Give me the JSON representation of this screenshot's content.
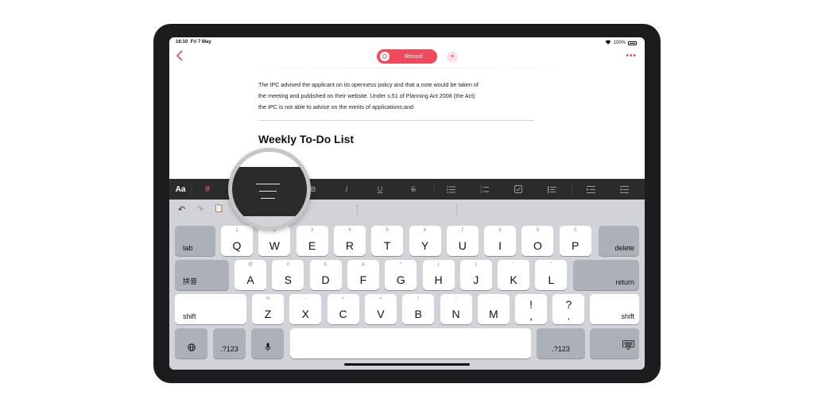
{
  "status": {
    "time": "16:10",
    "date": "Fri 7 May",
    "battery": "100%"
  },
  "nav": {
    "record_label": "Record",
    "more": "•••",
    "back": "‹",
    "sparkle": "✦"
  },
  "doc": {
    "paragraph_lines": [
      "The IPC advised the applicant on its openness policy and that a note would be taken of",
      "the meeting and published on their website. Under s.51 of Planning Act 2008 (the Act)",
      "the IPC is not able to advise on the merits of applications;and"
    ],
    "heading": "Weekly To-Do List"
  },
  "toolbar": {
    "aa": "Aa",
    "hash": "#",
    "bold": "B",
    "italic": "I",
    "underline": "U",
    "strike": "S",
    "bullets": "☰",
    "numbers": "≡",
    "checkbox": "☑",
    "quote": "❘≡",
    "indent_in": "⇥",
    "indent_out": "⇤"
  },
  "keyboard": {
    "row1": [
      {
        "main": "Q",
        "sub": "1"
      },
      {
        "main": "W",
        "sub": "2"
      },
      {
        "main": "E",
        "sub": "3"
      },
      {
        "main": "R",
        "sub": "4"
      },
      {
        "main": "T",
        "sub": "5"
      },
      {
        "main": "Y",
        "sub": "6"
      },
      {
        "main": "U",
        "sub": "7"
      },
      {
        "main": "I",
        "sub": "8"
      },
      {
        "main": "O",
        "sub": "9"
      },
      {
        "main": "P",
        "sub": "0"
      }
    ],
    "row2": [
      {
        "main": "A",
        "sub": "@"
      },
      {
        "main": "S",
        "sub": "#"
      },
      {
        "main": "D",
        "sub": "£"
      },
      {
        "main": "F",
        "sub": "&"
      },
      {
        "main": "G",
        "sub": "*"
      },
      {
        "main": "H",
        "sub": "("
      },
      {
        "main": "J",
        "sub": ")"
      },
      {
        "main": "K",
        "sub": "'"
      },
      {
        "main": "L",
        "sub": "\""
      }
    ],
    "row3": [
      {
        "main": "Z",
        "sub": "%"
      },
      {
        "main": "X",
        "sub": "-"
      },
      {
        "main": "C",
        "sub": "+"
      },
      {
        "main": "V",
        "sub": "="
      },
      {
        "main": "B",
        "sub": "/"
      },
      {
        "main": "N",
        "sub": ";"
      },
      {
        "main": "M",
        "sub": ":"
      },
      {
        "main": "!",
        "sub": "",
        "second": ","
      },
      {
        "main": "?",
        "sub": "",
        "second": "."
      }
    ],
    "tab": "tab",
    "delete": "delete",
    "pinyin": "拼音",
    "return": "return",
    "shift": "shift",
    "num_left": ".?123",
    "num_right": ".?123",
    "globe": "🌐",
    "mic": "🎤",
    "kb_hide": "⌨",
    "undo": "↶",
    "redo": "↷",
    "paste": "📋"
  }
}
